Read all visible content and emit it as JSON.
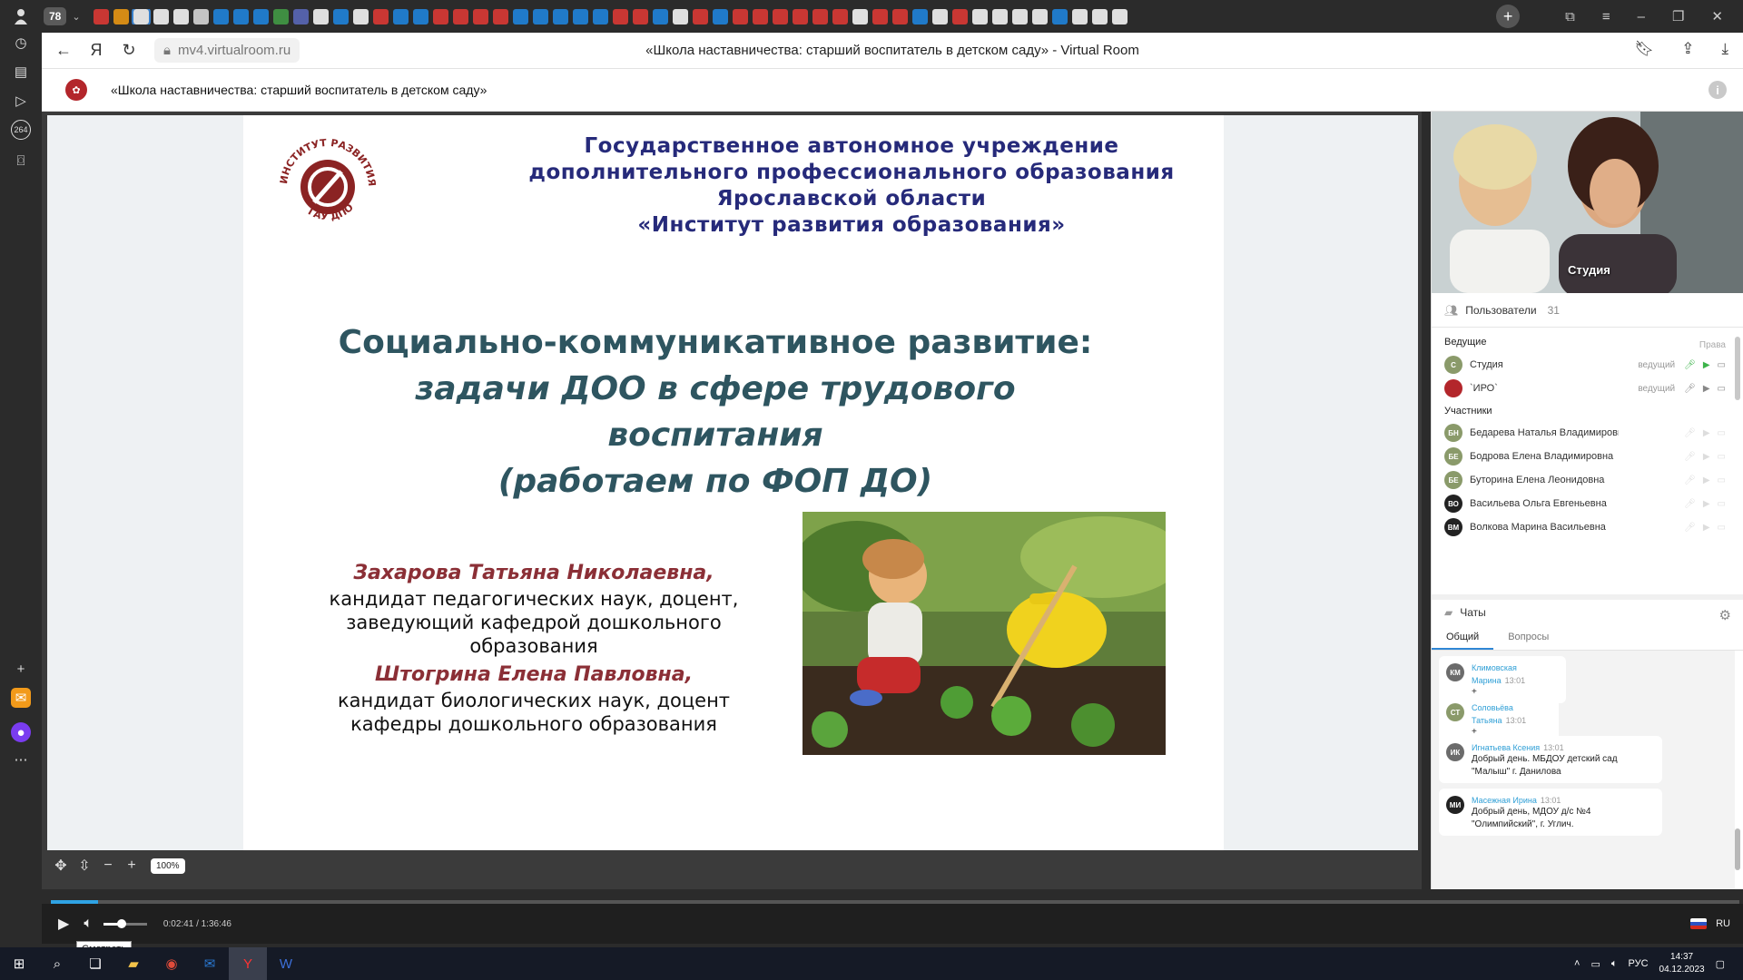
{
  "browser": {
    "tab_count": "78",
    "url": "mv4.virtualroom.ru",
    "page_title": "«Школа наставничества: старший воспитатель в детском саду» - Virtual Room",
    "sidebar_badge": "264"
  },
  "app": {
    "room_title": "«Школа наставничества: старший воспитатель в детском саду»"
  },
  "slide": {
    "org_lines": [
      "Государственное автономное учреждение",
      "дополнительного профессионального образования",
      "Ярославской области",
      "«Институт развития образования»"
    ],
    "logo_text": "ИНСТИТУТ РАЗВИТИЯ ОБРАЗОВАНИЯ",
    "logo_subtext": "ГАУ ДПО ЯО",
    "title_line1": "Социально-коммуникативное развитие:",
    "title_line2": "задачи ДОО в сфере трудового воспитания",
    "title_line3": "(работаем по ФОП ДО)",
    "author1_name": "Захарова Татьяна Николаевна,",
    "author1_desc": "кандидат педагогических наук, доцент, заведующий кафедрой дошкольного образования",
    "author2_name": "Штогрина Елена Павловна,",
    "author2_desc": "кандидат биологических наук, доцент кафедры дошкольного образования"
  },
  "slide_controls": {
    "zoom": "100%"
  },
  "player": {
    "time": "0:02:41 / 1:36:46",
    "progress": 0.0277,
    "volume": 0.4,
    "lang": "RU",
    "tooltip": "Смотреть"
  },
  "video": {
    "label": "Студия"
  },
  "users": {
    "header": "Пользователи",
    "count": "31",
    "hosts_label": "Ведущие",
    "rights_label": "Права",
    "participants_label": "Участники",
    "hosts": [
      {
        "initials": "С",
        "name": "Студия",
        "role": "ведущий",
        "color": "#8a9a6a"
      },
      {
        "initials": "",
        "name": "`ИРО`",
        "role": "ведущий",
        "color": "#b3262b"
      }
    ],
    "participants": [
      {
        "initials": "БН",
        "name": "Бедарева Наталья Владимировна",
        "color": "#8a9a6a"
      },
      {
        "initials": "БЕ",
        "name": "Бодрова Елена Владимировна",
        "color": "#8a9a6a"
      },
      {
        "initials": "БЕ",
        "name": "Буторина Елена Леонидовна",
        "color": "#8a9a6a"
      },
      {
        "initials": "ВО",
        "name": "Васильева Ольга Евгеньевна",
        "color": "#222222"
      },
      {
        "initials": "ВМ",
        "name": "Волкова Марина Васильевна",
        "color": "#222222"
      }
    ]
  },
  "chats": {
    "header": "Чаты",
    "tab_general": "Общий",
    "tab_questions": "Вопросы",
    "messages": [
      {
        "initials": "КМ",
        "author": "Климовская Марина",
        "time": "13:01",
        "text": "+",
        "color": "#6b6b6b"
      },
      {
        "initials": "СТ",
        "author": "Соловьёва Татьяна",
        "time": "13:01",
        "text": "+",
        "color": "#8a9a6a"
      },
      {
        "initials": "ИК",
        "author": "Игнатьева Ксения",
        "time": "13:01",
        "text": "Добрый день. МБДОУ детский сад \"Малыш\" г. Данилова",
        "color": "#6b6b6b"
      },
      {
        "initials": "МИ",
        "author": "Масежная Ирина",
        "time": "13:01",
        "text": "Добрый день, МДОУ д/с №4 \"Олимпийский\", г. Углич.",
        "color": "#222222"
      }
    ]
  },
  "taskbar": {
    "lang": "РУС",
    "time": "14:37",
    "date": "04.12.2023"
  },
  "colors": {
    "accent": "#2fa3e4",
    "org_text": "#262a7a",
    "title_text": "#2e5560",
    "author_name": "#8b2f36",
    "brand_red": "#b3262b"
  }
}
